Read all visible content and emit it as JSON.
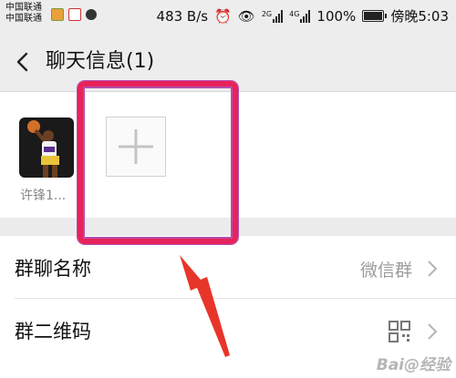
{
  "status_bar": {
    "carrier_1": "中国联通",
    "carrier_2": "中国联通",
    "net_speed": "483 B/s",
    "net_type_1": "2G",
    "net_type_2": "4G",
    "battery": "100%",
    "time": "傍晚5:03"
  },
  "header": {
    "title": "聊天信息(1)"
  },
  "members": [
    {
      "name": "许锋1..."
    }
  ],
  "settings": [
    {
      "label": "群聊名称",
      "value": "微信群"
    },
    {
      "label": "群二维码"
    }
  ],
  "watermark": "Bai@经验",
  "colors": {
    "highlight": "#e8235a",
    "arrow": "#e8352a"
  }
}
